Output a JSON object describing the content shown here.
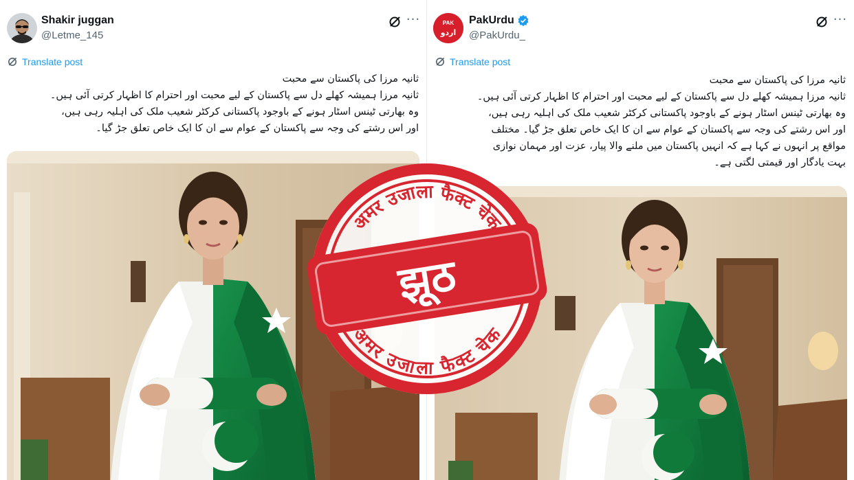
{
  "left_post": {
    "display_name": "Shakir juggan",
    "handle": "@Letme_145",
    "translate_label": "Translate post",
    "more_label": "···",
    "lines": [
      "ثانیہ مرزا کی پاکستان سے محبت",
      "ثانیہ مرزا ہمیشہ کھلے دل سے پاکستان کے لیے محبت اور احترام کا اظہار کرتی آئی ہیں۔",
      "وہ بھارتی ٹینس اسٹار ہونے کے باوجود پاکستانی کرکٹر شعیب ملک کی اہلیہ رہی ہیں،",
      "اور اس رشتے کی وجہ سے پاکستان کے عوام سے ان کا ایک خاص تعلق جڑ گیا۔"
    ]
  },
  "right_post": {
    "display_name": "PakUrdu",
    "handle": "@PakUrdu_",
    "verified": true,
    "translate_label": "Translate post",
    "more_label": "···",
    "avatar_text_top": "PAK",
    "avatar_text_bottom": "اردو",
    "lines": [
      "ثانیہ مرزا کی پاکستان سے محبت",
      "ثانیہ مرزا ہمیشہ کھلے دل سے پاکستان کے لیے محبت اور احترام کا اظہار کرتی آئی ہیں۔",
      "وہ بھارتی ٹینس اسٹار ہونے کے باوجود پاکستانی کرکٹر شعیب ملک کی اہلیہ رہی ہیں،",
      "اور اس رشتے کی وجہ سے پاکستان کے عوام سے ان کا ایک خاص تعلق جڑ گیا۔ مختلف",
      "مواقع پر انہوں نے کہا ہے کہ انہیں پاکستان میں ملنے والا پیار، عزت اور مہمان نوازی",
      "بہت یادگار اور قیمتی لگتی ہے۔"
    ]
  },
  "stamp": {
    "top_arc": "अमर उजाला फैक्ट चेक",
    "bottom_arc": "अमर उजाला फैक्ट चेक",
    "label": "झूठ",
    "color": "#d7262f"
  },
  "colors": {
    "link": "#1d9bf0",
    "secondary_text": "#536471",
    "verified": "#1d9bf0",
    "pak_green": "#0d7a3b",
    "stamp_red": "#d7262f"
  }
}
